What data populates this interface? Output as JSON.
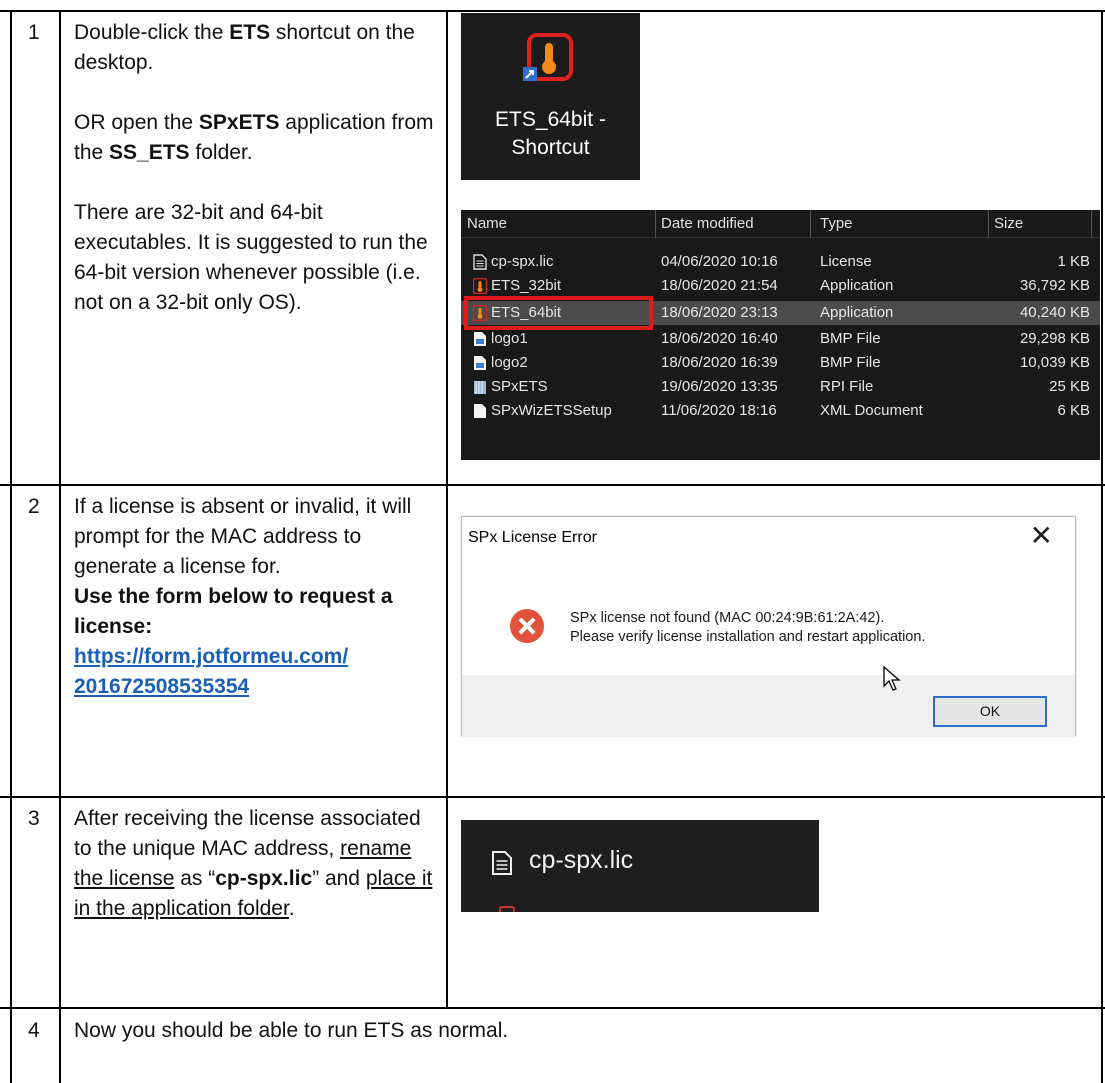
{
  "rows": [
    {
      "number": "1",
      "text": {
        "p1_a": "Double-click the ",
        "p1_b": "ETS",
        "p1_c": " shortcut on the desktop.",
        "p2_a": "OR open the ",
        "p2_b": "SPxETS",
        "p2_c": " application from the ",
        "p2_d": "SS_ETS",
        "p2_e": " folder.",
        "p3": "There are 32-bit and 64-bit executables.  It is suggested to run the 64-bit version whenever possible (i.e. not on a 32-bit only OS)."
      },
      "shortcut": {
        "line1": "ETS_64bit -",
        "line2": "Shortcut"
      },
      "explorer": {
        "columns": [
          "Name",
          "Date modified",
          "Type",
          "Size"
        ],
        "files": [
          {
            "icon": "text-file-icon",
            "name": "cp-spx.lic",
            "date": "04/06/2020 10:16",
            "type": "License",
            "size": "1 KB"
          },
          {
            "icon": "thermometer-app-icon",
            "name": "ETS_32bit",
            "date": "18/06/2020 21:54",
            "type": "Application",
            "size": "36,792 KB"
          },
          {
            "icon": "thermometer-app-icon",
            "name": "ETS_64bit",
            "date": "18/06/2020 23:13",
            "type": "Application",
            "size": "40,240 KB"
          },
          {
            "icon": "bmp-file-icon",
            "name": "logo1",
            "date": "18/06/2020 16:40",
            "type": "BMP File",
            "size": "29,298 KB"
          },
          {
            "icon": "bmp-file-icon",
            "name": "logo2",
            "date": "18/06/2020 16:39",
            "type": "BMP File",
            "size": "10,039 KB"
          },
          {
            "icon": "rpi-file-icon",
            "name": "SPxETS",
            "date": "19/06/2020 13:35",
            "type": "RPI File",
            "size": "25 KB"
          },
          {
            "icon": "xml-file-icon",
            "name": "SPxWizETSSetup",
            "date": "11/06/2020 18:16",
            "type": "XML Document",
            "size": "6 KB"
          }
        ]
      }
    },
    {
      "number": "2",
      "text": {
        "p1": "If a license is absent or invalid, it will prompt for the MAC address to generate a license for.",
        "p2": "Use the form below to request a license:",
        "link_line1": "https://form.jotformeu.com/",
        "link_line2": "201672508535354"
      },
      "dialog": {
        "title": "SPx License Error",
        "close": "✕",
        "message1": "SPx license not found (MAC 00:24:9B:61:2A:42).",
        "message2": "Please verify license installation and restart application.",
        "ok": "OK"
      }
    },
    {
      "number": "3",
      "text": {
        "a": "After receiving the license associated to the unique MAC address, ",
        "b": "rename the license",
        "c": " as “",
        "d": "cp-spx.lic",
        "e": "” and ",
        "f": "place it in the application folder",
        "g": "."
      },
      "file": {
        "name": "cp-spx.lic"
      }
    },
    {
      "number": "4",
      "text": "Now you should be able to run ETS as normal."
    }
  ],
  "colors": {
    "accent_red": "#e01b1b",
    "link_blue": "#1a5fb4",
    "dark_bg": "#191919"
  }
}
